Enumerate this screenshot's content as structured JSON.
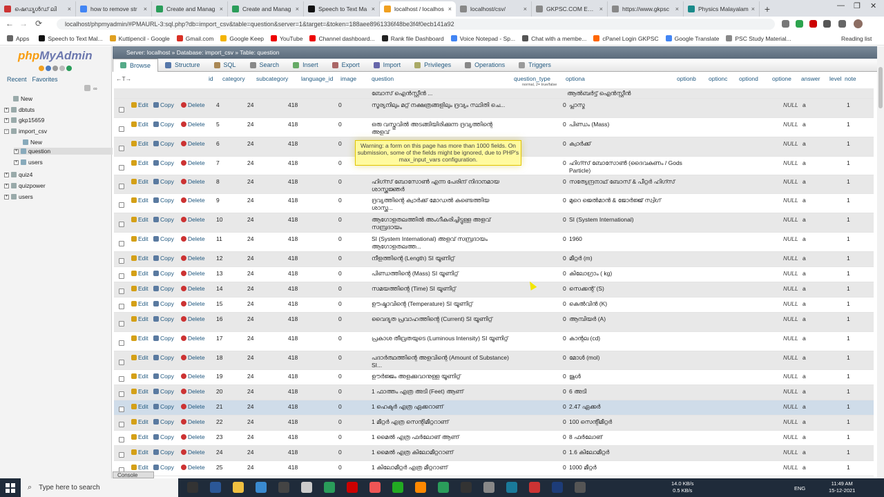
{
  "browser": {
    "tabs": [
      {
        "title": "ഷെഡ്യൂൾഡ് ലി",
        "color": "#c33"
      },
      {
        "title": "how to remove str",
        "color": "#4285f4"
      },
      {
        "title": "Create and Manag",
        "color": "#2a9d5a"
      },
      {
        "title": "Create and Manag",
        "color": "#2a9d5a"
      },
      {
        "title": "Speech to Text Ma",
        "color": "#111"
      },
      {
        "title": "localhost / localhos",
        "color": "#f0a020"
      },
      {
        "title": "localhost/csv/",
        "color": "#888"
      },
      {
        "title": "GKPSC.COM EXAM",
        "color": "#888"
      },
      {
        "title": "https://www.gkpsc",
        "color": "#888"
      },
      {
        "title": "Physics Malayalam",
        "color": "#1a8a8a"
      }
    ],
    "active_tab_index": 5,
    "url": "localhost/phpmyadmin/#PMAURL-3:sql.php?db=import_csv&table=question&server=1&target=&token=188aee8961336f48be3f4f0ecb141a92",
    "bookmarks": [
      {
        "label": "Apps",
        "color": "#666"
      },
      {
        "label": "Speech to Text Mal...",
        "color": "#111"
      },
      {
        "label": "Kuttipencil - Google",
        "color": "#e0a020"
      },
      {
        "label": "Gmail.com",
        "color": "#d93025"
      },
      {
        "label": "Google Keep",
        "color": "#f4b400"
      },
      {
        "label": "YouTube",
        "color": "#e00"
      },
      {
        "label": "Channel dashboard...",
        "color": "#e00"
      },
      {
        "label": "Rank file Dashboard",
        "color": "#222"
      },
      {
        "label": "Voice Notepad - Sp...",
        "color": "#4285f4"
      },
      {
        "label": "Chat with a membe...",
        "color": "#555"
      },
      {
        "label": "cPanel Login GKPSC",
        "color": "#f60"
      },
      {
        "label": "Google Translate",
        "color": "#4285f4"
      },
      {
        "label": "PSC Study Material...",
        "color": "#888"
      }
    ],
    "reading_list": "Reading list"
  },
  "sidebar": {
    "logo_php": "php",
    "logo_myadmin": "MyAdmin",
    "tabs": [
      "Recent",
      "Favorites"
    ],
    "tree": [
      {
        "label": "New",
        "indent": 0
      },
      {
        "label": "dbtuts",
        "indent": 0
      },
      {
        "label": "gkp15659",
        "indent": 0
      },
      {
        "label": "import_csv",
        "indent": 0
      },
      {
        "label": "New",
        "indent": 1
      },
      {
        "label": "question",
        "indent": 1
      },
      {
        "label": "users",
        "indent": 1
      },
      {
        "label": "quiz4",
        "indent": 0
      },
      {
        "label": "quizpower",
        "indent": 0
      },
      {
        "label": "users",
        "indent": 0
      }
    ]
  },
  "breadcrumb": {
    "server": "Server: localhost",
    "database": "Database: import_csv",
    "table": "Table: question"
  },
  "menu_tabs": [
    "Browse",
    "Structure",
    "SQL",
    "Search",
    "Insert",
    "Export",
    "Import",
    "Privileges",
    "Operations",
    "Triggers"
  ],
  "columns": [
    "id",
    "category",
    "subcategory",
    "language_id",
    "image",
    "question",
    "question_type",
    "optiona",
    "optionb",
    "optionc",
    "optiond",
    "optione",
    "answer",
    "level",
    "note"
  ],
  "question_type_sub": "normal, 2= true/false",
  "actions": {
    "edit": "Edit",
    "copy": "Copy",
    "delete": "Delete"
  },
  "partial_row": {
    "question": "ബോസ് ഐൻസ്റ്റീൻ ...",
    "optiona": "ആൽബർട്ട് ഐൻസ്റ്റീൻ"
  },
  "rows": [
    {
      "id": "4",
      "category": "24",
      "subcategory": "418",
      "language_id": "0",
      "question": "സൂര്യനിലും മറ്റ് നക്ഷത്രങ്ങളിലും ദ്രവ്യം സ്ഥിതി ചെ...",
      "question_type": "0",
      "optiona": "പ്ലാസ്മ",
      "optione": "NULL",
      "answer": "a",
      "level": "1"
    },
    {
      "id": "5",
      "category": "24",
      "subcategory": "418",
      "language_id": "0",
      "question": "ഒരു വസ്തുവിൽ അടങ്ങിയിരിക്കുന്ന ദ്രവ്യത്തിന്റെ അളവ്",
      "question_type": "0",
      "optiona": "പിണ്ഡം (Mass)",
      "optione": "NULL",
      "answer": "a",
      "level": "1"
    },
    {
      "id": "6",
      "category": "24",
      "subcategory": "418",
      "language_id": "0",
      "question": "",
      "question_type": "0",
      "optiona": "ക്വാർക്ക്",
      "optione": "NULL",
      "answer": "a",
      "level": "1"
    },
    {
      "id": "7",
      "category": "24",
      "subcategory": "418",
      "language_id": "0",
      "question": "",
      "question_type": "0",
      "optiona": "ഹിഗ്സ് ബോസോൺ (ദൈവകണം / Gods Particle)",
      "optione": "NULL",
      "answer": "a",
      "level": "1"
    },
    {
      "id": "8",
      "category": "24",
      "subcategory": "418",
      "language_id": "0",
      "question": "ഹിഗ്സ് ബോസോൺ എന്ന പേരിന് നിദാനമായ ശാസ്ത്രജ്ഞർ",
      "question_type": "0",
      "optiona": "സത്യേന്ദ്രനാഥ് ബോസ് & പീറ്റർ ഹിഗ്സ്",
      "optione": "NULL",
      "answer": "a",
      "level": "1"
    },
    {
      "id": "9",
      "category": "24",
      "subcategory": "418",
      "language_id": "0",
      "question": "ദ്രവ്യത്തിന്റെ ക്വാർക്ക് മോഡൽ കണ്ടെത്തിയ ശാസ്ത്ര...",
      "question_type": "0",
      "optiona": "മുറെ ജെൽമാൻ & ജോർജ്ജ് സ്വിഗ്",
      "optione": "NULL",
      "answer": "a",
      "level": "1"
    },
    {
      "id": "10",
      "category": "24",
      "subcategory": "418",
      "language_id": "0",
      "question": "ആഗോളതലത്തിൽ അംഗീകരിച്ചിട്ടുള്ള അളവ് സമ്പ്രദായം",
      "question_type": "0",
      "optiona": "SI (System International)",
      "optione": "NULL",
      "answer": "a",
      "level": "1"
    },
    {
      "id": "11",
      "category": "24",
      "subcategory": "418",
      "language_id": "0",
      "question": "SI (System International) അളവ് സമ്പ്രദായം ആഗോളതലത്ത...",
      "question_type": "0",
      "optiona": "1960",
      "optione": "NULL",
      "answer": "a",
      "level": "1"
    },
    {
      "id": "12",
      "category": "24",
      "subcategory": "418",
      "language_id": "0",
      "question": "നീളത്തിന്റെ (Length) SI യൂണിറ്റ്",
      "question_type": "0",
      "optiona": "മീറ്റർ (m)",
      "optione": "NULL",
      "answer": "a",
      "level": "1"
    },
    {
      "id": "13",
      "category": "24",
      "subcategory": "418",
      "language_id": "0",
      "question": "പിണ്ഡത്തിന്റെ (Mass) SI യൂണിറ്റ്",
      "question_type": "0",
      "optiona": "കിലോഗ്രാം ( kg)",
      "optione": "NULL",
      "answer": "a",
      "level": "1"
    },
    {
      "id": "14",
      "category": "24",
      "subcategory": "418",
      "language_id": "0",
      "question": "സമയത്തിന്റെ (Time) SI യൂണിറ്റ്",
      "question_type": "0",
      "optiona": "സെക്കന്റ് (S)",
      "optione": "NULL",
      "answer": "a",
      "level": "1"
    },
    {
      "id": "15",
      "category": "24",
      "subcategory": "418",
      "language_id": "0",
      "question": "ഊഷ്മാവിന്റെ (Temperature) SI യൂണിറ്റ്",
      "question_type": "0",
      "optiona": "കെൽവിൻ (K)",
      "optione": "NULL",
      "answer": "a",
      "level": "1"
    },
    {
      "id": "16",
      "category": "24",
      "subcategory": "418",
      "language_id": "0",
      "question": "വൈദ്യുത പ്രവാഹത്തിന്റെ (Current) SI യൂണിറ്റ്",
      "question_type": "0",
      "optiona": "ആമ്പിയർ (A)",
      "optione": "NULL",
      "answer": "a",
      "level": "1"
    },
    {
      "id": "17",
      "category": "24",
      "subcategory": "418",
      "language_id": "0",
      "question": "പ്രകാശ തീവ്രതയുടെ (Luminous Intensity) SI യൂണിറ്റ്",
      "question_type": "0",
      "optiona": "കാന്റല (cd)",
      "optione": "NULL",
      "answer": "a",
      "level": "1"
    },
    {
      "id": "18",
      "category": "24",
      "subcategory": "418",
      "language_id": "0",
      "question": "പദാർത്ഥത്തിന്റെ അളവിന്റെ (Amount of Substance) SI...",
      "question_type": "0",
      "optiona": "മോൾ (mol)",
      "optione": "NULL",
      "answer": "a",
      "level": "1"
    },
    {
      "id": "19",
      "category": "24",
      "subcategory": "418",
      "language_id": "0",
      "question": "ഊർജ്ജം അളക്കുവാനുള്ള യൂണിറ്റ്",
      "question_type": "0",
      "optiona": "ജൂൾ",
      "optione": "NULL",
      "answer": "a",
      "level": "1"
    },
    {
      "id": "20",
      "category": "24",
      "subcategory": "418",
      "language_id": "0",
      "question": "1 ഫാത്തം എത്ര അടി (Feet) ആണ്",
      "question_type": "0",
      "optiona": "6 അടി",
      "optione": "NULL",
      "answer": "a",
      "level": "1"
    },
    {
      "id": "21",
      "category": "24",
      "subcategory": "418",
      "language_id": "0",
      "question": "1 ഹെക്ടർ എത്ര ഏക്കറാണ്",
      "question_type": "0",
      "optiona": "2.47 ഏക്കർ",
      "optione": "NULL",
      "answer": "a",
      "level": "1"
    },
    {
      "id": "22",
      "category": "24",
      "subcategory": "418",
      "language_id": "0",
      "question": "1 മീറ്റർ എത്ര സെന്റിമീറ്ററാണ്",
      "question_type": "0",
      "optiona": "100 സെന്റീമീറ്റർ",
      "optione": "NULL",
      "answer": "a",
      "level": "1"
    },
    {
      "id": "23",
      "category": "24",
      "subcategory": "418",
      "language_id": "0",
      "question": "1 മൈൽ എത്ര ഫർലോങ് ആണ്",
      "question_type": "0",
      "optiona": "8 ഫർലോങ്",
      "optione": "NULL",
      "answer": "a",
      "level": "1"
    },
    {
      "id": "24",
      "category": "24",
      "subcategory": "418",
      "language_id": "0",
      "question": "1 മൈൽ എത്ര കിലോമീറ്ററാണ്",
      "question_type": "0",
      "optiona": "1.6 കിലോമീറ്റർ",
      "optione": "NULL",
      "answer": "a",
      "level": "1"
    },
    {
      "id": "25",
      "category": "24",
      "subcategory": "418",
      "language_id": "0",
      "question": "1 കിലോമീറ്റർ എത്ര മീറ്ററാണ്",
      "question_type": "0",
      "optiona": "1000 മീറ്റർ",
      "optione": "NULL",
      "answer": "a",
      "level": "1"
    }
  ],
  "highlighted_row_id": "21",
  "warning": "Warning: a form on this page has more than 1000 fields. On submission, some of the fields might be ignored, due to PHP's max_input_vars configuration.",
  "console_label": "Console",
  "taskbar": {
    "search_placeholder": "Type here to search",
    "net_up": "14.0 KB/s",
    "net_down": "0.5 KB/s",
    "lang": "ENG",
    "time": "11:49 AM",
    "date": "15-12-2021"
  }
}
